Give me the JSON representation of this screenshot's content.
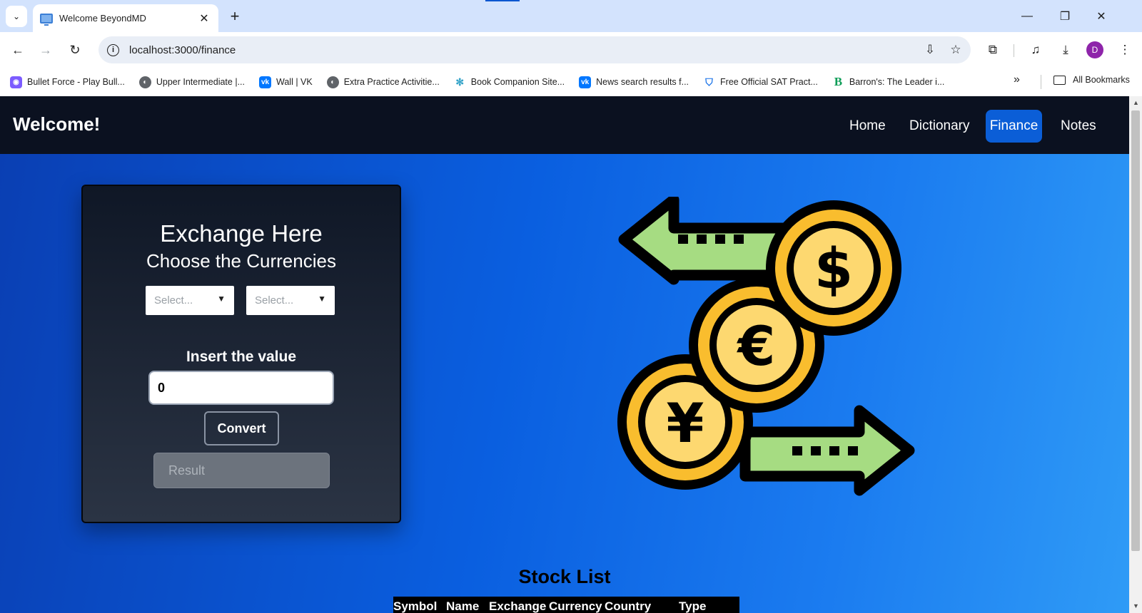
{
  "browser": {
    "tab_title": "Welcome BeyondMD",
    "url": "localhost:3000/finance",
    "bookmarks": [
      {
        "label": "Bullet Force - Play Bull...",
        "color": "#7c5cff"
      },
      {
        "label": "Upper Intermediate |...",
        "color": "#5f6368"
      },
      {
        "label": "Wall | VK",
        "color": "#0077ff"
      },
      {
        "label": "Extra Practice Activitie...",
        "color": "#5f6368"
      },
      {
        "label": "Book Companion Site...",
        "color": "#34a3c8"
      },
      {
        "label": "News search results f...",
        "color": "#0077ff"
      },
      {
        "label": "Free Official SAT Pract...",
        "color": "#1a73e8"
      },
      {
        "label": "Barron's: The Leader i...",
        "color": "#0f9d58"
      }
    ],
    "all_bookmarks": "All Bookmarks",
    "profile_initial": "D"
  },
  "navbar": {
    "brand": "Welcome!",
    "links": [
      {
        "label": "Home",
        "active": false
      },
      {
        "label": "Dictionary",
        "active": false
      },
      {
        "label": "Finance",
        "active": true
      },
      {
        "label": "Notes",
        "active": false
      }
    ]
  },
  "exchange": {
    "title": "Exchange Here",
    "subtitle": "Choose the Currencies",
    "from_placeholder": "Select...",
    "to_placeholder": "Select...",
    "value_label": "Insert the value",
    "value": "0",
    "convert_label": "Convert",
    "result_placeholder": "Result"
  },
  "illustration": {
    "icons": [
      "dollar-coin-icon",
      "euro-coin-icon",
      "yen-coin-icon",
      "arrow-left-icon",
      "arrow-right-icon"
    ],
    "symbols": [
      "$",
      "€",
      "¥"
    ]
  },
  "stocks": {
    "title": "Stock List",
    "columns": [
      "Symbol",
      "Name",
      "Exchange",
      "Currency",
      "Country",
      "Type"
    ]
  },
  "colors": {
    "navbar_bg": "#0b1120",
    "active_link": "#0b5ed7",
    "coin_gold": "#f9bd2e",
    "coin_light": "#fdd870",
    "arrow_green": "#a6dc82"
  }
}
